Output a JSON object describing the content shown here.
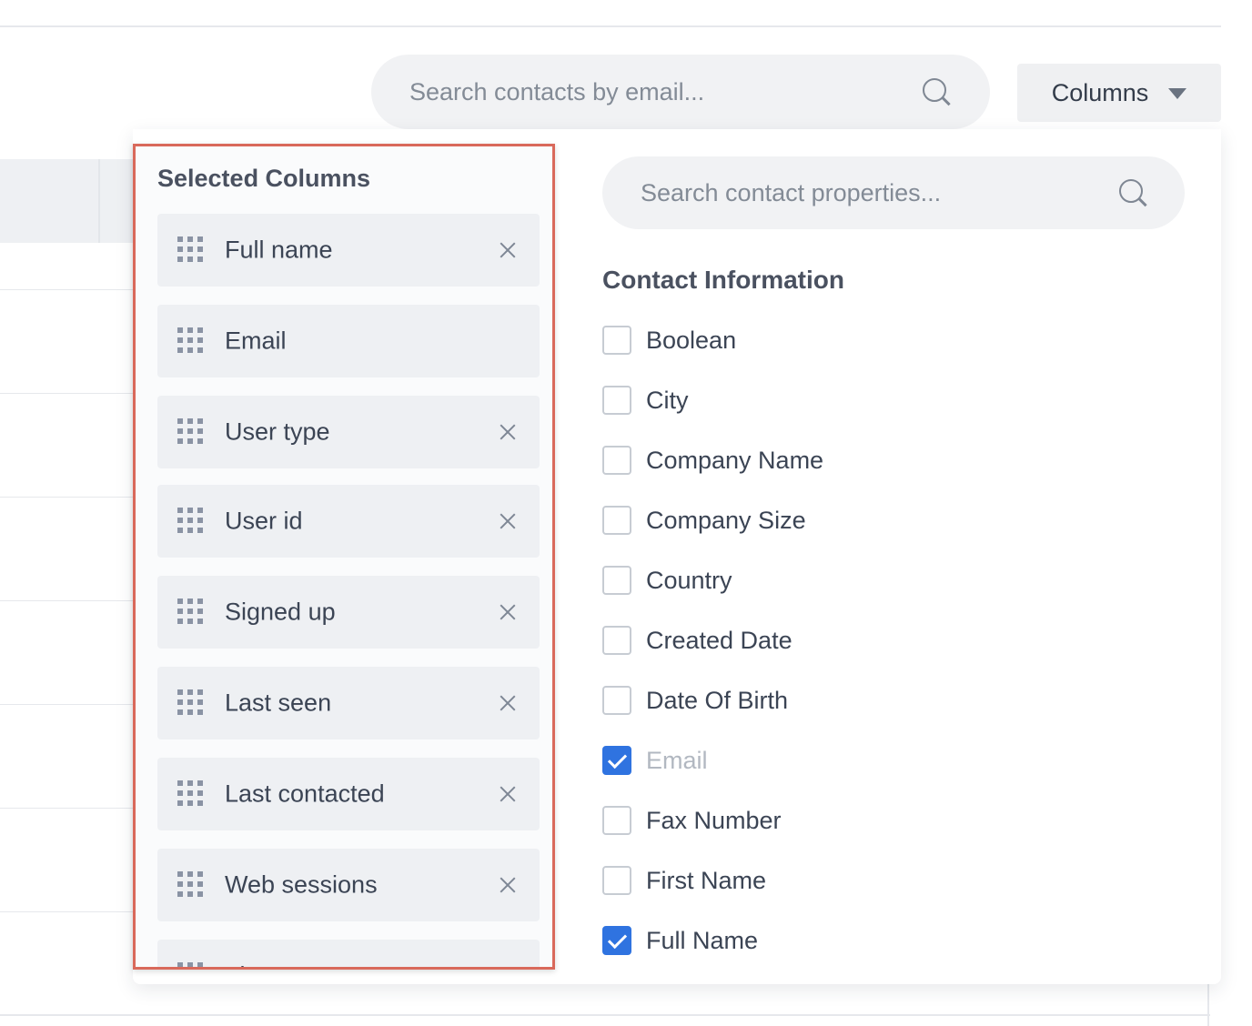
{
  "toolbar": {
    "search_placeholder": "Search contacts by email...",
    "columns_button_label": "Columns"
  },
  "selected_columns": {
    "title": "Selected Columns",
    "items": [
      {
        "label": "Full name",
        "removable": true
      },
      {
        "label": "Email",
        "removable": false
      },
      {
        "label": "User type",
        "removable": true
      },
      {
        "label": "User id",
        "removable": true
      },
      {
        "label": "Signed up",
        "removable": true
      },
      {
        "label": "Last seen",
        "removable": true
      },
      {
        "label": "Last contacted",
        "removable": true
      },
      {
        "label": "Web sessions",
        "removable": true
      },
      {
        "label": "First...",
        "removable": true
      }
    ]
  },
  "properties": {
    "search_placeholder": "Search contact properties...",
    "section_title": "Contact Information",
    "items": [
      {
        "label": "Boolean",
        "checked": false
      },
      {
        "label": "City",
        "checked": false
      },
      {
        "label": "Company Name",
        "checked": false
      },
      {
        "label": "Company Size",
        "checked": false
      },
      {
        "label": "Country",
        "checked": false
      },
      {
        "label": "Created Date",
        "checked": false
      },
      {
        "label": "Date Of Birth",
        "checked": false
      },
      {
        "label": "Email",
        "checked": true,
        "disabled": true
      },
      {
        "label": "Fax Number",
        "checked": false
      },
      {
        "label": "First Name",
        "checked": false
      },
      {
        "label": "Full Name",
        "checked": true
      }
    ]
  },
  "colors": {
    "highlight_border": "#d9695b",
    "checkbox_checked": "#2f73e0"
  }
}
